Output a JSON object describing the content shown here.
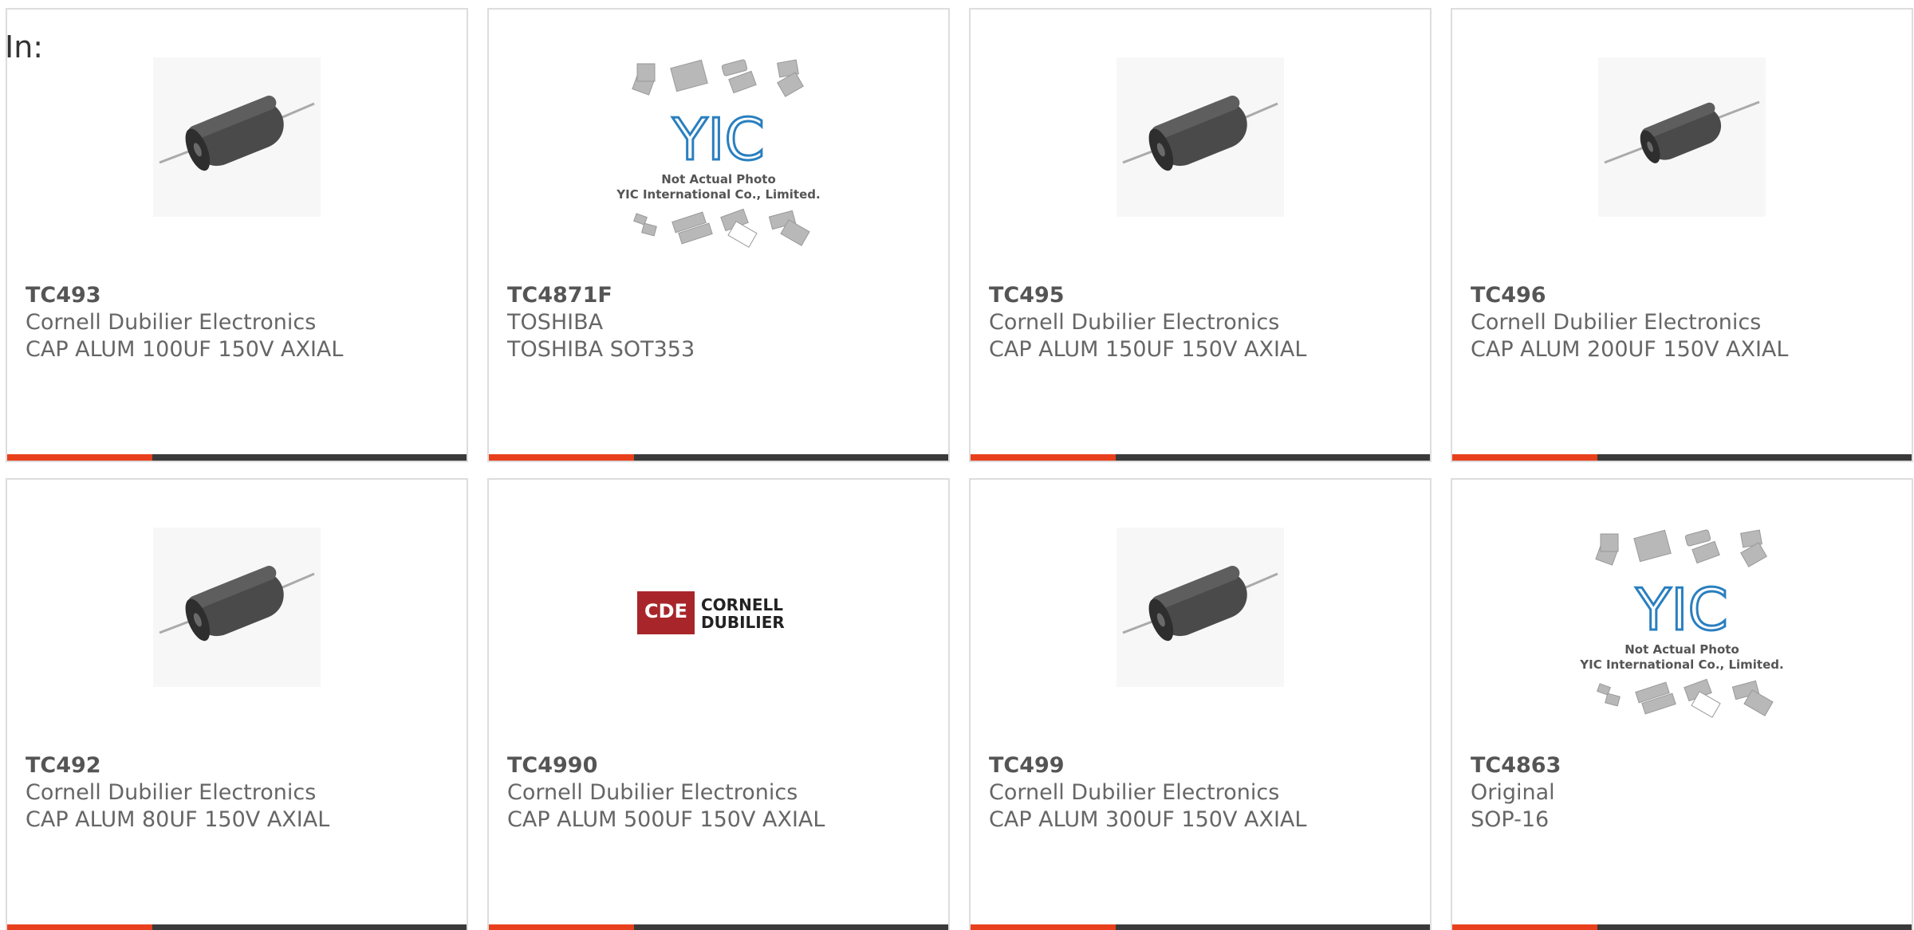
{
  "header": {
    "label": "In:"
  },
  "colors": {
    "accent": "#e8401c",
    "bar": "#3a3a3a",
    "brand_red": "#b22222"
  },
  "cards": [
    {
      "part": "TC493",
      "maker": "Cornell Dubilier Electronics",
      "desc": "CAP ALUM 100UF 150V AXIAL",
      "image": "capacitor-image"
    },
    {
      "part": "TC4871F",
      "maker": "TOSHIBA",
      "desc": "TOSHIBA SOT353",
      "image": "placeholder-image",
      "placeholder": {
        "logo": "YIC",
        "line1": "Not Actual Photo",
        "line2": "YIC International Co., Limited."
      }
    },
    {
      "part": "TC495",
      "maker": "Cornell Dubilier Electronics",
      "desc": "CAP ALUM 150UF 150V AXIAL",
      "image": "capacitor-image"
    },
    {
      "part": "TC496",
      "maker": "Cornell Dubilier Electronics",
      "desc": "CAP ALUM 200UF 150V AXIAL",
      "image": "capacitor-image"
    },
    {
      "part": "TC492",
      "maker": "Cornell Dubilier Electronics",
      "desc": "CAP ALUM 80UF 150V AXIAL",
      "image": "capacitor-image"
    },
    {
      "part": "TC4990",
      "maker": "Cornell Dubilier Electronics",
      "desc": "CAP ALUM 500UF 150V AXIAL",
      "image": "brand-logo-image",
      "logo": {
        "mark": "CDE",
        "line1": "CORNELL",
        "line2": "DUBILIER"
      }
    },
    {
      "part": "TC499",
      "maker": "Cornell Dubilier Electronics",
      "desc": "CAP ALUM 300UF 150V AXIAL",
      "image": "capacitor-image"
    },
    {
      "part": "TC4863",
      "maker": "Original",
      "desc": "SOP-16",
      "image": "placeholder-image",
      "placeholder": {
        "logo": "YIC",
        "line1": "Not Actual Photo",
        "line2": "YIC International Co., Limited."
      }
    }
  ]
}
